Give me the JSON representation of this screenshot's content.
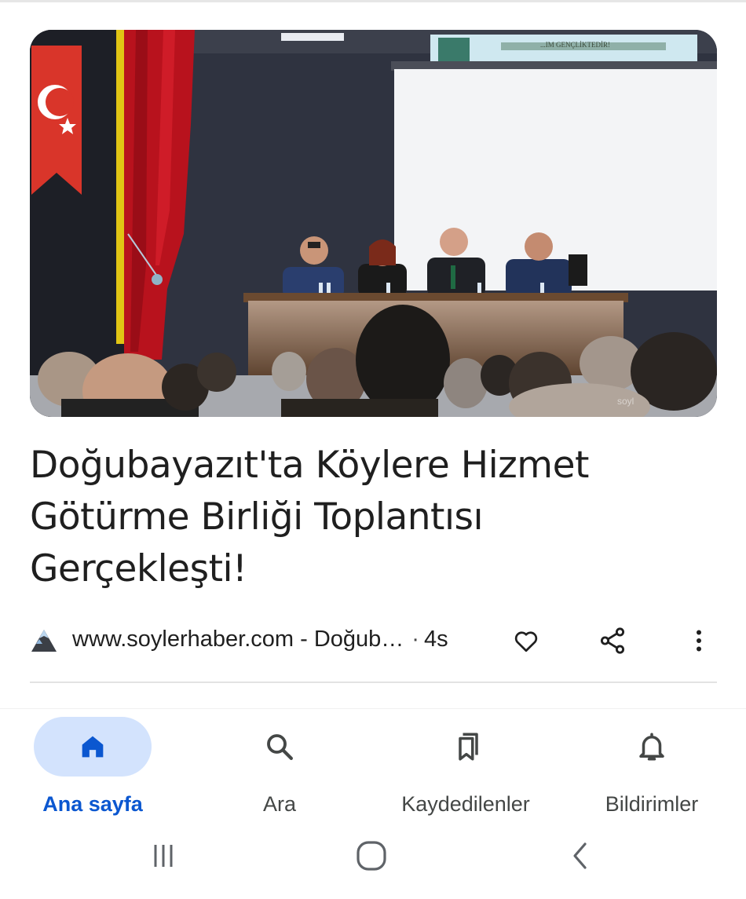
{
  "article": {
    "image_watermark_text": "...IM GENÇLİKTEDİR!",
    "image_corner_mark": "soyl",
    "headline": "Doğubayazıt'ta Köylere Hizmet Götürme Birliği Toplantısı Gerçekleşti!",
    "source": "www.soylerhaber.com - Doğub…",
    "age_separator": "·",
    "age": "4s"
  },
  "icons": {
    "source_logo": "mountain-logo-icon",
    "like": "heart-outline-icon",
    "share": "share-icon",
    "more": "more-vert-icon"
  },
  "bottom_nav": {
    "items": [
      {
        "label": "Ana sayfa",
        "icon": "home-icon",
        "active": true
      },
      {
        "label": "Ara",
        "icon": "search-icon",
        "active": false
      },
      {
        "label": "Kaydedilenler",
        "icon": "bookmarks-icon",
        "active": false
      },
      {
        "label": "Bildirimler",
        "icon": "bell-icon",
        "active": false
      }
    ]
  },
  "system_nav": {
    "recents": "recents-icon",
    "home": "home-circle-icon",
    "back": "back-icon"
  },
  "colors": {
    "accent": "#0b57d0",
    "active_pill": "#d3e3fd",
    "text": "#1f1f1f",
    "secondary_text": "#444746"
  }
}
